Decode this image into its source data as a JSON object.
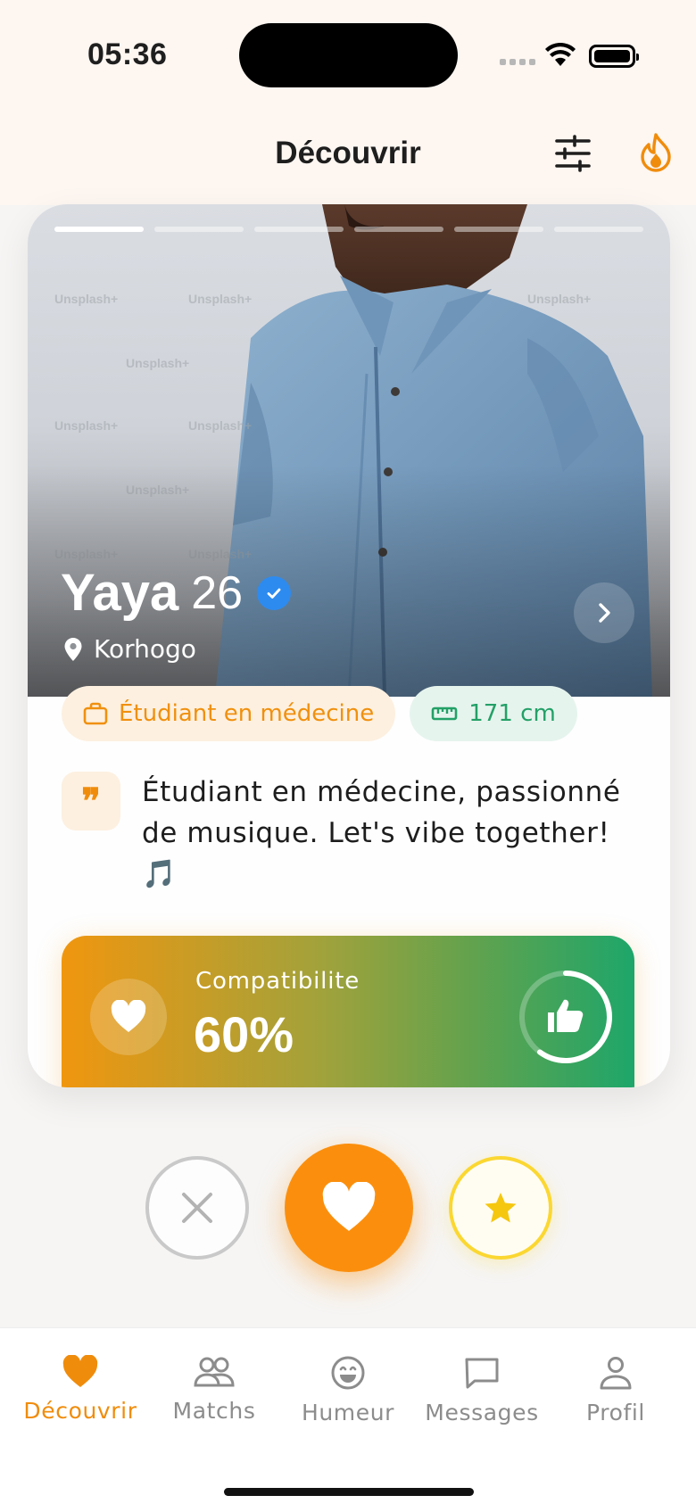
{
  "status_bar": {
    "time": "05:36"
  },
  "header": {
    "title": "Découvrir"
  },
  "profile": {
    "name": "Yaya",
    "age": "26",
    "location": "Korhogo",
    "job": "Étudiant en médecine",
    "height": "171 cm",
    "bio": "Étudiant en médecine, passionné de musique. Let's vibe together! 🎵",
    "photo_count": 6,
    "current_photo": 1,
    "verified": true
  },
  "compatibility": {
    "label": "Compatibilite",
    "value": "60%",
    "percent": 60
  },
  "nav": {
    "items": [
      {
        "label": "Découvrir",
        "icon": "heart-icon",
        "active": true
      },
      {
        "label": "Matchs",
        "icon": "people-icon",
        "active": false
      },
      {
        "label": "Humeur",
        "icon": "smiley-icon",
        "active": false
      },
      {
        "label": "Messages",
        "icon": "chat-icon",
        "active": false
      },
      {
        "label": "Profil",
        "icon": "person-icon",
        "active": false
      }
    ]
  },
  "colors": {
    "accent": "#f08c0c",
    "verified": "#2d8bf0",
    "green": "#1ea66a",
    "super": "#fbd731"
  }
}
